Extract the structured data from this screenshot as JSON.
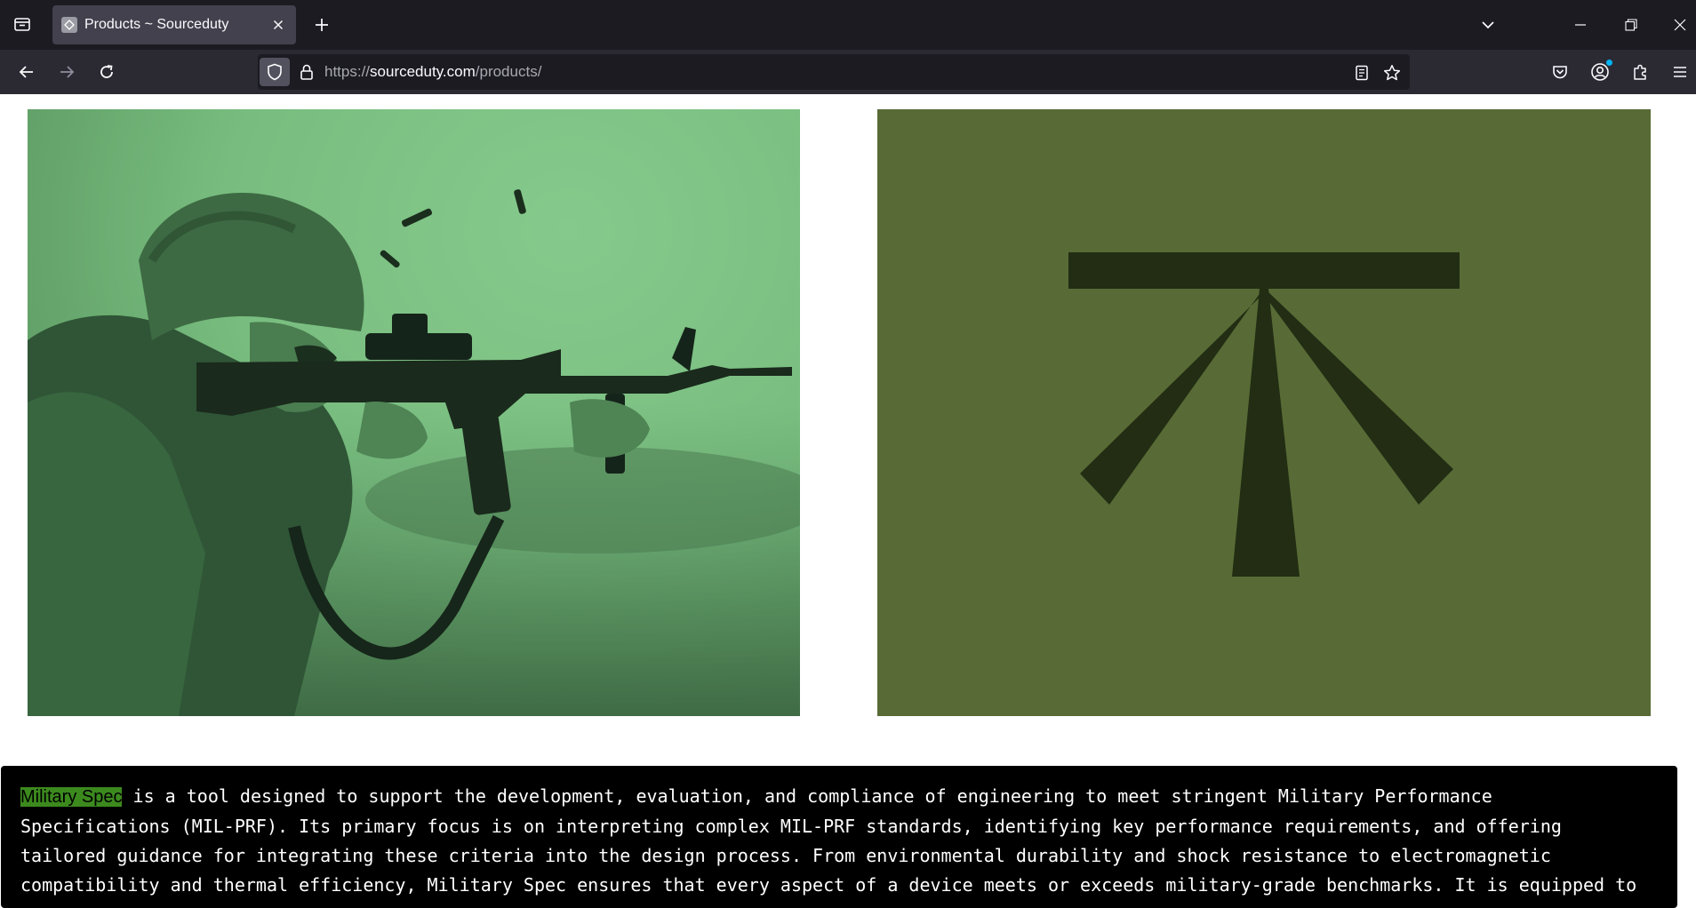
{
  "browser": {
    "tab": {
      "title": "Products ~ Sourceduty",
      "favicon": "generic-page-icon"
    },
    "url": {
      "scheme": "https://",
      "host": "sourceduty.com",
      "path": "/products/"
    },
    "icons": [
      "tab-list-icon",
      "close-icon",
      "plus-icon",
      "chevron-down-icon",
      "minimize-icon",
      "restore-icon",
      "window-close-icon",
      "back-icon",
      "forward-icon",
      "reload-icon",
      "shield-icon",
      "lock-icon",
      "reader-view-icon",
      "star-icon",
      "pocket-icon",
      "account-icon",
      "extensions-icon",
      "menu-icon"
    ],
    "accent_color": "#00b3f4"
  },
  "page": {
    "images": [
      {
        "name": "soldier-rifle-photo",
        "tint": "#78bd7f"
      },
      {
        "name": "military-spec-logo",
        "background": "#586b36",
        "mark_color": "#222d13"
      }
    ],
    "description": {
      "highlight": "Military Spec",
      "highlight_color": "#3c8a1e",
      "text": " is a tool designed to support the development, evaluation, and compliance of engineering to meet stringent Military Performance\nSpecifications (MIL-PRF). Its primary focus is on interpreting complex MIL-PRF standards, identifying key performance requirements, and offering\ntailored guidance for integrating these criteria into the design process. From environmental durability and shock resistance to electromagnetic\ncompatibility and thermal efficiency, Military Spec ensures that every aspect of a device meets or exceeds military-grade benchmarks. It is equipped to"
    }
  }
}
